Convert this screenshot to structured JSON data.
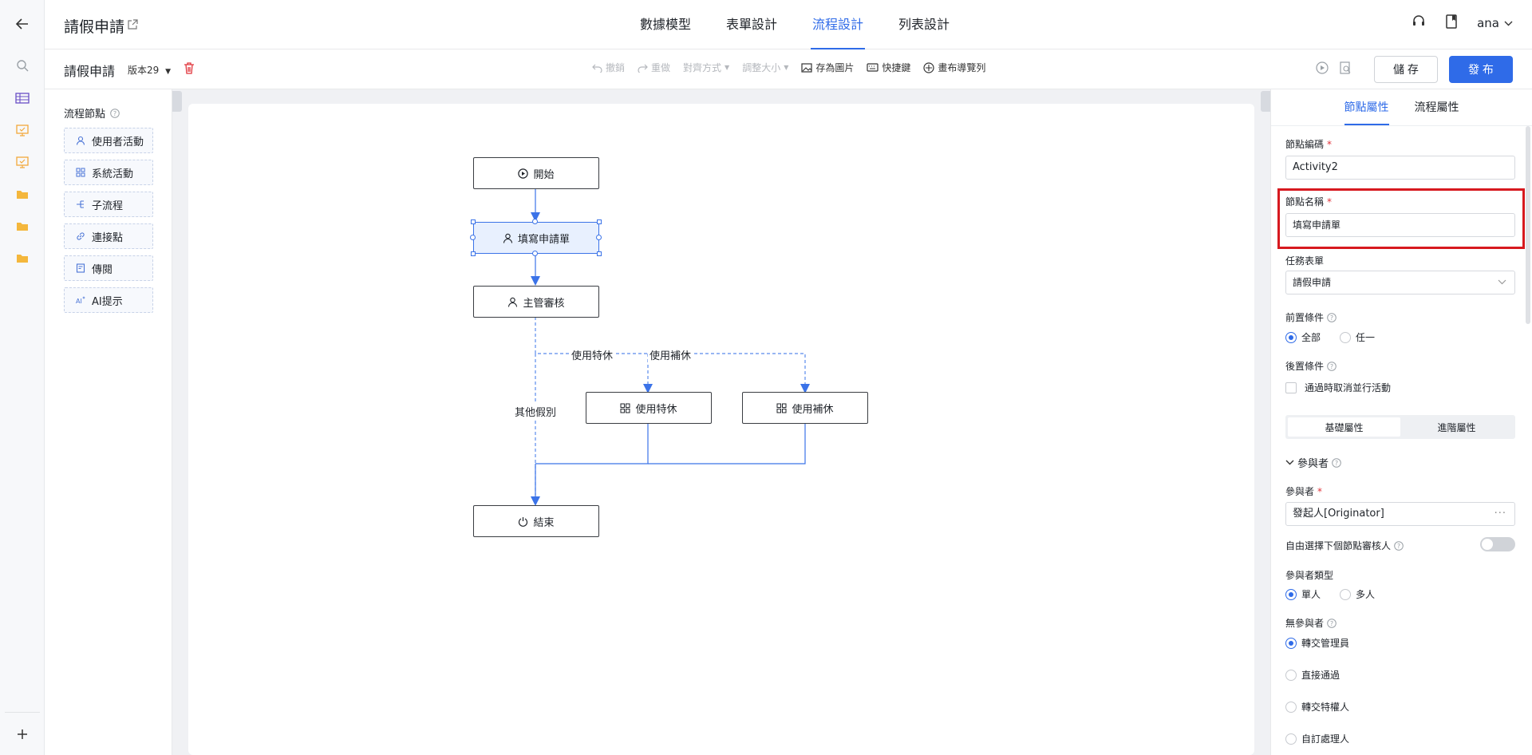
{
  "header": {
    "title": "請假申請",
    "tabs": [
      {
        "label": "數據模型",
        "active": false
      },
      {
        "label": "表單設計",
        "active": false
      },
      {
        "label": "流程設計",
        "active": true
      },
      {
        "label": "列表設計",
        "active": false
      }
    ],
    "user": "ana"
  },
  "toolbar": {
    "form_name": "請假申請",
    "version": "版本29",
    "tools": [
      {
        "label": "撤銷",
        "disabled": true
      },
      {
        "label": "重做",
        "disabled": true
      },
      {
        "label": "對齊方式",
        "disabled": true
      },
      {
        "label": "調整大小",
        "disabled": true
      },
      {
        "label": "存為圖片",
        "disabled": false
      },
      {
        "label": "快捷鍵",
        "disabled": false
      },
      {
        "label": "畫布導覽列",
        "disabled": false
      }
    ],
    "save_label": "儲 存",
    "publish_label": "發 布"
  },
  "node_panel": {
    "title": "流程節點",
    "items": [
      {
        "label": "使用者活動",
        "icon": "user-icon"
      },
      {
        "label": "系統活動",
        "icon": "grid-icon"
      },
      {
        "label": "子流程",
        "icon": "subflow-icon"
      },
      {
        "label": "連接點",
        "icon": "link-icon"
      },
      {
        "label": "傳閱",
        "icon": "circulate-icon"
      },
      {
        "label": "AI提示",
        "icon": "ai-icon"
      }
    ]
  },
  "flow": {
    "nodes": {
      "start": "開始",
      "fill": "填寫申請單",
      "review": "主管審核",
      "special": "使用特休",
      "comp": "使用補休",
      "end": "結束"
    },
    "edges": {
      "special": "使用特休",
      "comp": "使用補休",
      "other": "其他假別"
    }
  },
  "props": {
    "tabs": [
      {
        "label": "節點屬性",
        "active": true
      },
      {
        "label": "流程屬性",
        "active": false
      }
    ],
    "node_code_label": "節點編碼",
    "node_code": "Activity2",
    "node_name_label": "節點名稱",
    "node_name": "填寫申請單",
    "task_form_label": "任務表單",
    "task_form": "請假申請",
    "pre_cond_label": "前置條件",
    "pre_cond_options": [
      "全部",
      "任一"
    ],
    "post_cond_label": "後置條件",
    "post_cond_checkbox": "通過時取消並行活動",
    "seg": [
      "基礎屬性",
      "進階屬性"
    ],
    "participants_section": "參與者",
    "participant_label": "參與者",
    "participant_value": "發起人[Originator]",
    "free_select_label": "自由選擇下個節點審核人",
    "participant_type_label": "參與者類型",
    "participant_type_options": [
      "單人",
      "多人"
    ],
    "no_participant_label": "無參與者",
    "no_participant_options": [
      "轉交管理員",
      "直接通過",
      "轉交特權人",
      "自訂處理人"
    ]
  }
}
